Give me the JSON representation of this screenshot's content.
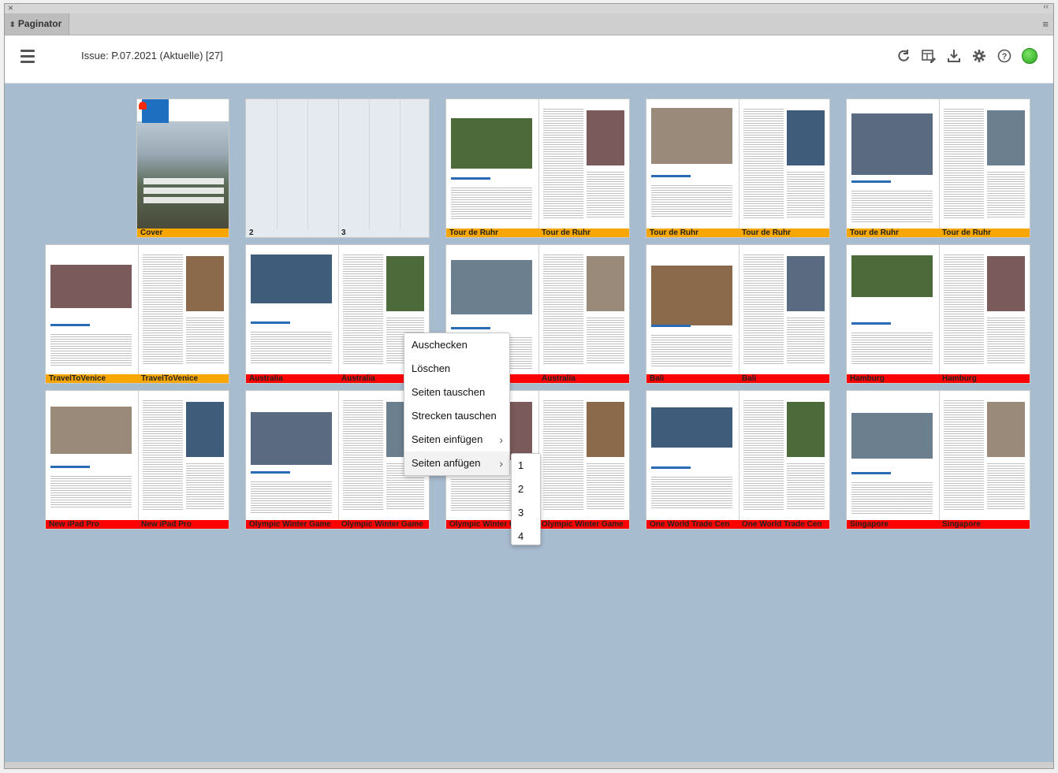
{
  "window": {
    "panel_title": "Paginator"
  },
  "toolbar": {
    "issue_label": "Issue: P.07.2021 (Aktuelle) [27]",
    "icons": [
      "refresh-icon",
      "layout-edit-icon",
      "download-icon",
      "gear-icon",
      "help-icon",
      "status-online-icon"
    ],
    "status_color": "#2aa51a"
  },
  "spreads": [
    {
      "left": "Cover",
      "right": "",
      "color": "orange",
      "type": "cover"
    },
    {
      "left": "2",
      "right": "3",
      "color": "none",
      "type": "empty"
    },
    {
      "left": "Tour de Ruhr",
      "right": "Tour de Ruhr",
      "color": "orange",
      "type": "ruhr1"
    },
    {
      "left": "Tour de Ruhr",
      "right": "Tour de Ruhr",
      "color": "orange",
      "type": "ruhr2"
    },
    {
      "left": "Tour de Ruhr",
      "right": "Tour de Ruhr",
      "color": "orange",
      "type": "ruhr3"
    },
    {
      "left": "TravelToVenice",
      "right": "TravelToVenice",
      "color": "orange",
      "type": "venice"
    },
    {
      "left": "Australia",
      "right": "Australia",
      "color": "red",
      "type": "australia1"
    },
    {
      "left": "",
      "right": "Australia",
      "color": "red",
      "type": "australia2"
    },
    {
      "left": "Bali",
      "right": "Bali",
      "color": "red",
      "type": "bali"
    },
    {
      "left": "Hamburg",
      "right": "Hamburg",
      "color": "red",
      "type": "hamburg"
    },
    {
      "left": "New iPad Pro",
      "right": "New iPad Pro",
      "color": "red",
      "type": "ipad"
    },
    {
      "left": "Olympic Winter Game",
      "right": "Olympic Winter Game",
      "color": "red",
      "type": "olympic1"
    },
    {
      "left": "Olympic Winter G",
      "right": "Olympic Winter Game",
      "color": "red",
      "type": "olympic2"
    },
    {
      "left": "One World Trade Cen",
      "right": "One World Trade Cen",
      "color": "red",
      "type": "wtc"
    },
    {
      "left": "Singapore",
      "right": "Singapore",
      "color": "red",
      "type": "singapore"
    }
  ],
  "context_menu": {
    "items": [
      "Auschecken",
      "Löschen",
      "Seiten tauschen",
      "Strecken tauschen",
      "Seiten einfügen",
      "Seiten anfügen"
    ]
  },
  "submenu": {
    "items": [
      "1",
      "2",
      "3",
      "4"
    ]
  }
}
